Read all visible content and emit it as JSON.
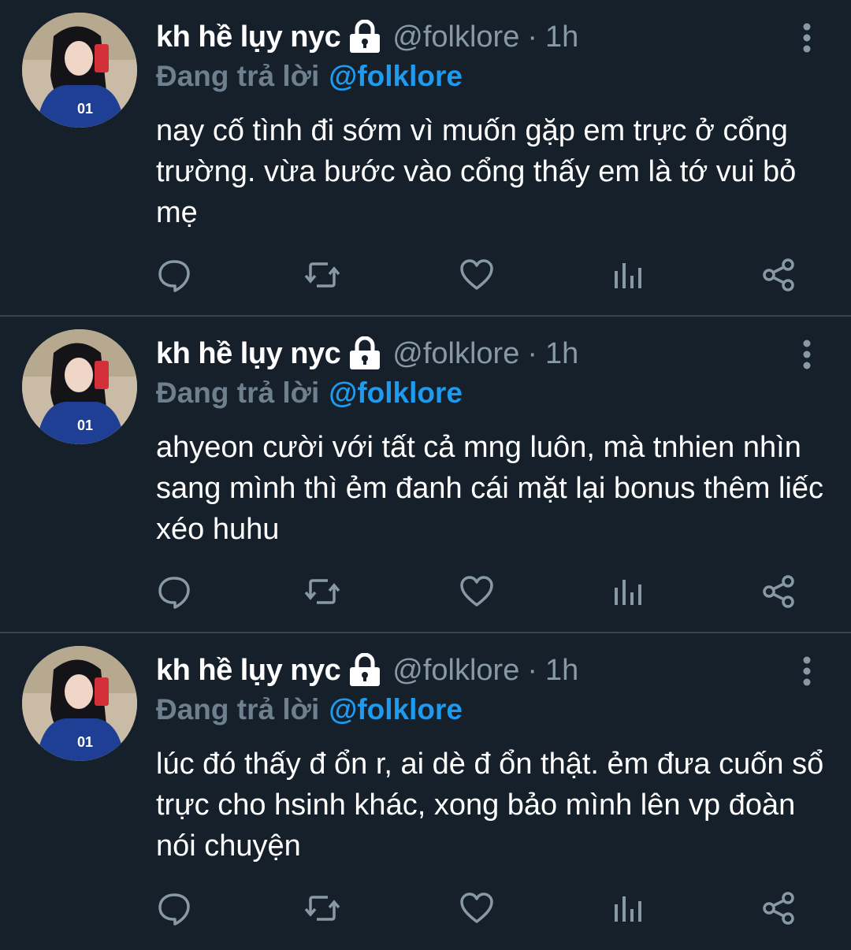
{
  "colors": {
    "background": "#15202b",
    "divider": "#38444d",
    "secondary_text": "#8899a6",
    "accent": "#1d9bf0"
  },
  "tweets": [
    {
      "name": "kh hề lụy nyc",
      "handle": "@folklore",
      "separator": "·",
      "time": "1h",
      "replying_prefix": "Đang trả lời",
      "replying_to": "@folklore",
      "text": "nay cố tình đi sớm vì muốn gặp em trực ở cổng trường. vừa bước vào cổng thấy em là tớ vui bỏ mẹ",
      "icons": [
        "lock-icon",
        "more-icon",
        "reply-icon",
        "retweet-icon",
        "like-icon",
        "stats-icon",
        "share-icon"
      ]
    },
    {
      "name": "kh hề lụy nyc",
      "handle": "@folklore",
      "separator": "·",
      "time": "1h",
      "replying_prefix": "Đang trả lời",
      "replying_to": "@folklore",
      "text": "ahyeon cười với tất cả mng luôn, mà tnhien nhìn sang mình thì ẻm đanh cái mặt lại bonus thêm liếc xéo huhu",
      "icons": [
        "lock-icon",
        "more-icon",
        "reply-icon",
        "retweet-icon",
        "like-icon",
        "stats-icon",
        "share-icon"
      ]
    },
    {
      "name": "kh hề lụy nyc",
      "handle": "@folklore",
      "separator": "·",
      "time": "1h",
      "replying_prefix": "Đang trả lời",
      "replying_to": "@folklore",
      "text": "lúc đó thấy đ ổn r, ai dè đ ổn thật. ẻm đưa cuốn sổ trực cho hsinh khác, xong bảo mình lên vp đoàn nói chuyện",
      "icons": [
        "lock-icon",
        "more-icon",
        "reply-icon",
        "retweet-icon",
        "like-icon",
        "stats-icon",
        "share-icon"
      ]
    }
  ]
}
